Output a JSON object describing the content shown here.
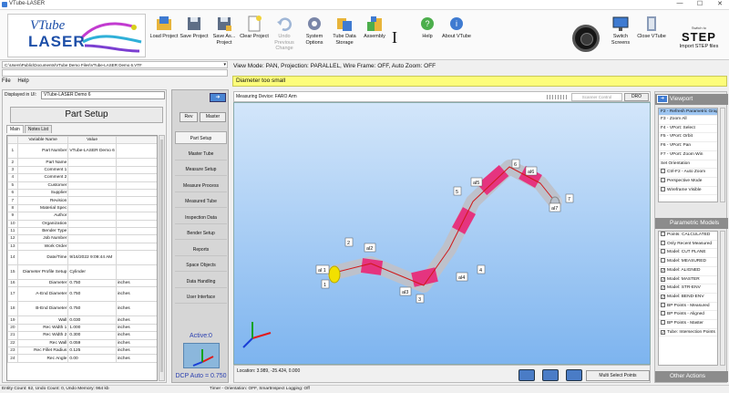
{
  "window": {
    "title": "VTube-LASER",
    "minimize": "—",
    "maximize": "☐",
    "close": "✕"
  },
  "logo": {
    "line1": "VTube",
    "line2": "LASER"
  },
  "toolbar": {
    "load": "Load Project",
    "save": "Save Project",
    "save_as": "Save As... Project",
    "clear": "Clear Project",
    "undo": "Undo Previous Change",
    "system_options": "System Options",
    "data_storage": "Tube Data Storage",
    "assembly": "Assembly",
    "cursor": "I",
    "help": "Help",
    "about": "About VTube",
    "switch_screens": "Switch Screens",
    "close_vtube": "Close VTube",
    "step_small": "Switch to",
    "step_big": "STEP",
    "step_label": "Import STEP files"
  },
  "project_path": "C:\\Users\\Public\\Documents\\VTube Demo Files\\VTube-LASER Demo 6.VTF",
  "menu": {
    "file": "File",
    "help": "Help"
  },
  "viewmode": "View Mode: PAN, Projection: PARALLEL, Wire Frame: OFF, Auto Zoom: OFF",
  "warning": "Diameter too small",
  "left": {
    "displayed_label": "Displayed in UI:",
    "displayed_value": "VTube-LASER Demo 6",
    "title": "Part Setup",
    "tabs": [
      "Main",
      "Notes List"
    ],
    "header": {
      "name": "Variable Name",
      "value": "Value"
    },
    "rows": [
      [
        "1",
        "Part Number",
        "VTube-LASER Demo 6",
        ""
      ],
      [
        "2",
        "Part Name",
        "",
        ""
      ],
      [
        "3",
        "Comment 1",
        "",
        ""
      ],
      [
        "4",
        "Comment 2",
        "",
        ""
      ],
      [
        "5",
        "Customer",
        "",
        ""
      ],
      [
        "6",
        "Supplier",
        "",
        ""
      ],
      [
        "7",
        "Revision",
        "",
        ""
      ],
      [
        "8",
        "Material Spec",
        "",
        ""
      ],
      [
        "9",
        "Author",
        "",
        ""
      ],
      [
        "10",
        "Organization",
        "",
        ""
      ],
      [
        "11",
        "Bender Type",
        "",
        ""
      ],
      [
        "12",
        "Job Number",
        "",
        ""
      ],
      [
        "13",
        "Work Order",
        "",
        ""
      ],
      [
        "14",
        "Date/Time",
        "9/16/2022 9:09:44 AM",
        ""
      ],
      [
        "15",
        "Diameter Profile Setup",
        "Cylinder",
        ""
      ],
      [
        "16",
        "Diameter",
        "0.750",
        "inches"
      ],
      [
        "17",
        "A-End Diameter",
        "0.750",
        "inches"
      ],
      [
        "18",
        "B-End Diameter",
        "0.750",
        "inches"
      ],
      [
        "19",
        "Wall",
        "0.030",
        "inches"
      ],
      [
        "20",
        "Rec Width 1",
        "1.000",
        "inches"
      ],
      [
        "21",
        "Rec Width 2",
        "0.300",
        "inches"
      ],
      [
        "22",
        "Rec Wall",
        "0.059",
        "inches"
      ],
      [
        "23",
        "Rec Fillet Radius",
        "0.125",
        "inches"
      ],
      [
        "24",
        "Rec Angle",
        "0.00",
        "inches"
      ]
    ]
  },
  "mid": {
    "rev": "Rev",
    "master": "Master",
    "nav": [
      "Part Setup",
      "Master Tube",
      "Measure Setup",
      "Measure Process",
      "Measured Tube",
      "Inspection Data",
      "Bender Setup",
      "Reports",
      "Space Objects",
      "Data Handling",
      "User Interface"
    ],
    "active": "Active:0",
    "dcp": "DCP Auto = 0.750"
  },
  "viewport": {
    "device": "Measuring Device: FARO Arm",
    "scanner": "Scanner Control",
    "dro": "DRO",
    "location": "Location: 3.989, -25.424, 0.000",
    "multi_select": "Multi Select Points",
    "labels": [
      "1",
      "al 1",
      "2",
      "al2",
      "3",
      "al3",
      "4",
      "al4",
      "5",
      "al5",
      "6",
      "al6",
      "al7",
      "7"
    ]
  },
  "right": {
    "viewport_head": "Viewport",
    "viewport_items": [
      {
        "label": "F2 - Refresh Parametric Graphics",
        "selected": true,
        "check": ""
      },
      {
        "label": "F3 - Zoom All",
        "selected": false,
        "check": ""
      },
      {
        "label": "F4 - VPort: Select",
        "selected": false,
        "check": ""
      },
      {
        "label": "F5 - VPort: Orbit",
        "selected": false,
        "check": ""
      },
      {
        "label": "F6 - VPort: Pan",
        "selected": false,
        "check": ""
      },
      {
        "label": "F7 - VPort: Zoom Win",
        "selected": false,
        "check": ""
      },
      {
        "label": "Set Orientation",
        "selected": false,
        "check": ""
      },
      {
        "label": "Ctrl-F2 - Auto Zoom",
        "selected": false,
        "check": "box"
      },
      {
        "label": "Perspective Mode",
        "selected": false,
        "check": "box"
      },
      {
        "label": "Wireframe Visible",
        "selected": false,
        "check": "box"
      }
    ],
    "param_head": "Parametric Models",
    "param_items": [
      {
        "label": "Points: CALCULATED",
        "check": "box"
      },
      {
        "label": "Only Recent Measured",
        "check": "box"
      },
      {
        "label": "Model: CUT PLANE",
        "check": "box"
      },
      {
        "label": "Model: MEASURED",
        "check": "box"
      },
      {
        "label": "Model: ALIGNED",
        "check": "checked"
      },
      {
        "label": "Model: MASTER",
        "check": "checked"
      },
      {
        "label": "Model: STR-ENV",
        "check": "checked"
      },
      {
        "label": "Model: BEND-ENV",
        "check": "checked"
      },
      {
        "label": "BP Points - Measured",
        "check": "box"
      },
      {
        "label": "BP Points - Aligned",
        "check": "box"
      },
      {
        "label": "BP Points - Master",
        "check": "box"
      },
      {
        "label": "Tube: Intersection Points",
        "check": "checked"
      }
    ],
    "other_head": "Other Actions"
  },
  "status": {
    "left": "Entity Count: 62, Undo Count: 0, Undo Memory: 964 kb",
    "right": "Timer - Orientation: OFF, SmartInspect Logging: Off"
  },
  "colors": {
    "accent": "#3f7bd1",
    "warning_bg": "#fdfd7a",
    "tube_pink": "#e5347f",
    "tube_yellow": "#f2e000"
  }
}
